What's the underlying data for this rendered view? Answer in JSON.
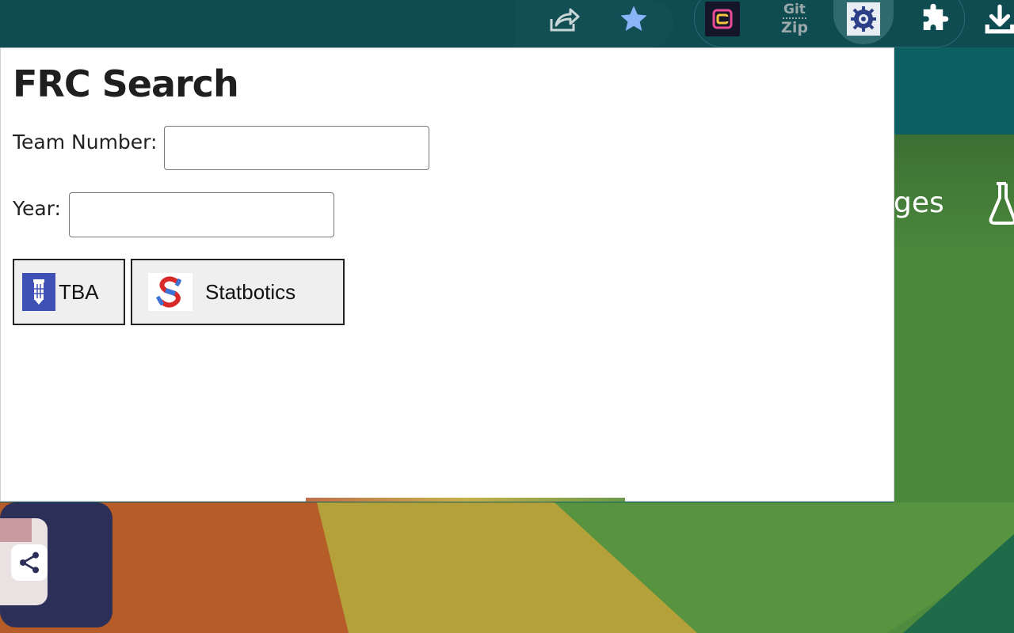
{
  "toolbar": {
    "icons": [
      "share-icon",
      "star-icon",
      "extension-c-icon",
      "gitzip-icon",
      "frc-gear-extension-icon",
      "puzzle-icon",
      "download-icon"
    ],
    "gitzip_line1": "Git",
    "gitzip_line2": "Zip",
    "star_color": "#8ab4f8"
  },
  "popup": {
    "title": "FRC Search",
    "team_label": "Team Number:",
    "team_value": "",
    "year_label": "Year:",
    "year_value": "",
    "tba_button": "TBA",
    "statbotics_button": "Statbotics"
  },
  "background": {
    "partial_text": "ges"
  },
  "colors": {
    "toolbar": "#0f4c52",
    "page": "#0f5e62",
    "orange": "#b65c28",
    "yellow": "#b4a13a",
    "green": "#4e8b3e",
    "navy": "#2c3058"
  }
}
